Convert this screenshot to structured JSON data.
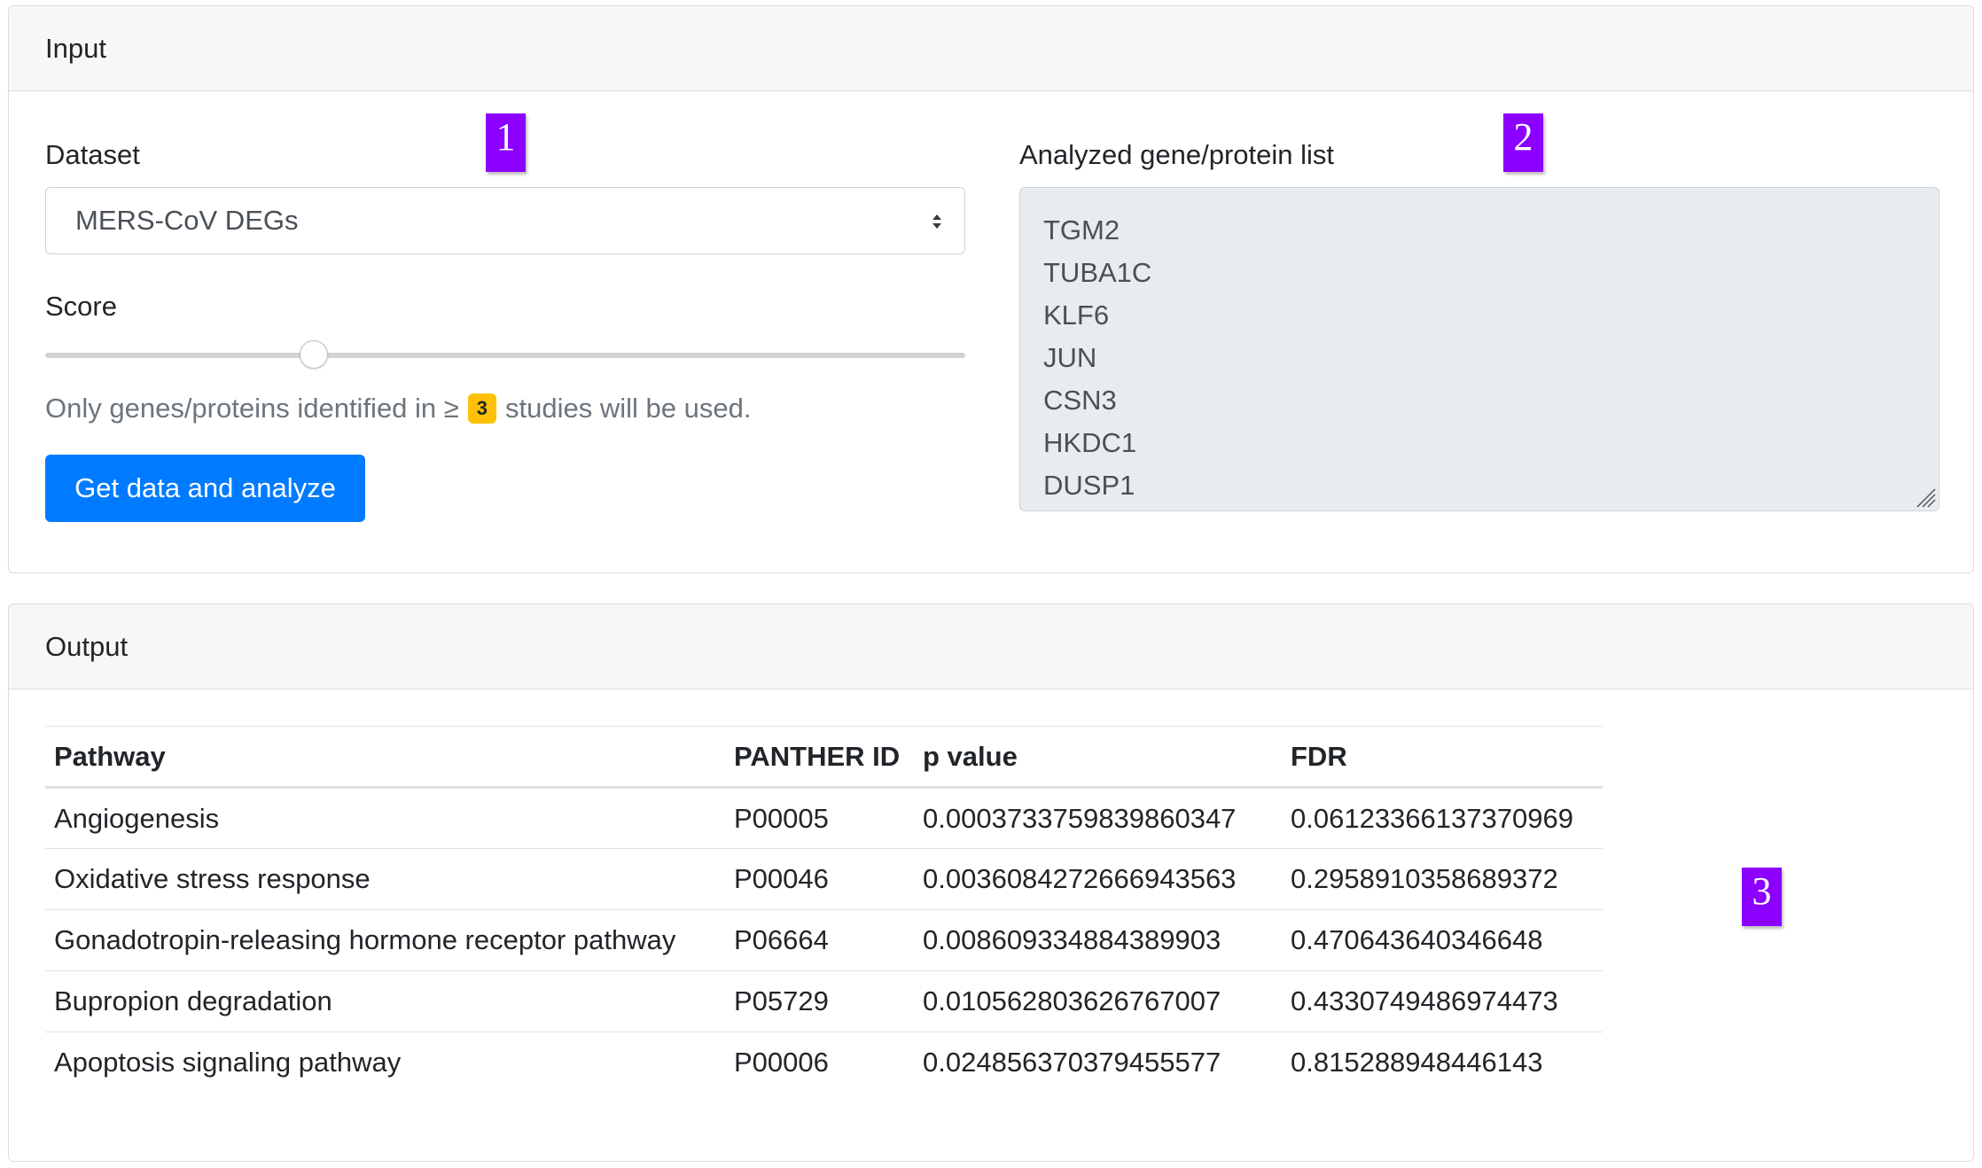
{
  "input": {
    "header": "Input",
    "dataset_label": "Dataset",
    "dataset_selected": "MERS-CoV DEGs",
    "score_label": "Score",
    "score_value": 3,
    "hint_before": "Only genes/proteins identified in ≥",
    "hint_after": "studies will be used.",
    "button_label": "Get data and analyze",
    "gene_list_label": "Analyzed gene/protein list",
    "genes": [
      "TGM2",
      "TUBA1C",
      "KLF6",
      "JUN",
      "CSN3",
      "HKDC1",
      "DUSP1"
    ]
  },
  "markers": [
    "1",
    "2",
    "3"
  ],
  "output": {
    "header": "Output",
    "columns": [
      "Pathway",
      "PANTHER ID",
      "p value",
      "FDR"
    ],
    "rows": [
      [
        "Angiogenesis",
        "P00005",
        "0.0003733759839860347",
        "0.06123366137370969"
      ],
      [
        "Oxidative stress response",
        "P00046",
        "0.0036084272666943563",
        "0.2958910358689372"
      ],
      [
        "Gonadotropin-releasing hormone receptor pathway",
        "P06664",
        "0.008609334884389903",
        "0.470643640346648"
      ],
      [
        "Bupropion degradation",
        "P05729",
        "0.010562803626767007",
        "0.4330749486974473"
      ],
      [
        "Apoptosis signaling pathway",
        "P00006",
        "0.024856370379455577",
        "0.815288948446143"
      ]
    ]
  },
  "colors": {
    "primary": "#007bff",
    "badge": "#ffc107",
    "marker": "#8b00ff"
  }
}
